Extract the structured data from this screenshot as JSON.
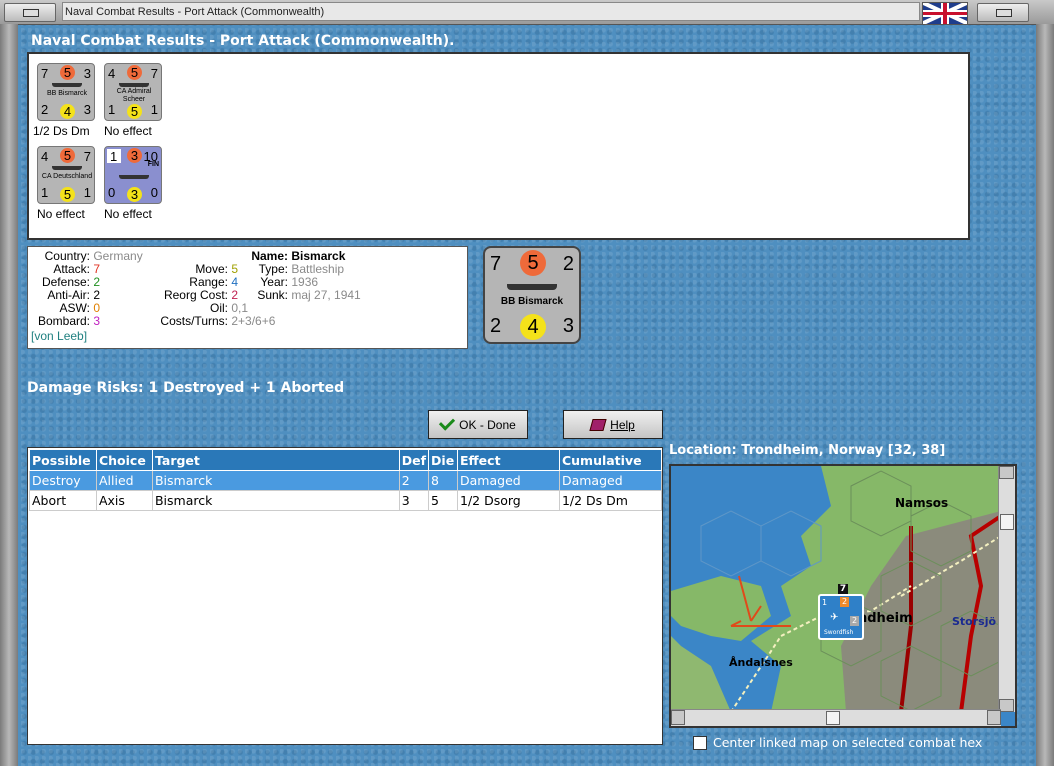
{
  "window": {
    "title": "Naval Combat Results - Port Attack (Commonwealth)"
  },
  "heading": "Naval Combat Results - Port Attack (Commonwealth).",
  "results": [
    {
      "top_left": "7",
      "top_circle": "5",
      "top_right": "3",
      "name": "BB Bismarck",
      "bottom_left": "2",
      "bottom_circle": "4",
      "bottom_right": "3",
      "caption": "1/2 Ds Dm"
    },
    {
      "top_left": "4",
      "top_circle": "5",
      "top_right": "7",
      "name": "CA Admiral Scheer",
      "bottom_left": "1",
      "bottom_circle": "5",
      "bottom_right": "1",
      "caption": "No effect"
    },
    {
      "top_left": "4",
      "top_circle": "5",
      "top_right": "7",
      "name": "CA Deutschland",
      "bottom_left": "1",
      "bottom_circle": "5",
      "bottom_right": "1",
      "caption": "No effect"
    },
    {
      "top_left": "1",
      "top_circle": "3",
      "top_right": "10",
      "tag": "FIN",
      "bottom_left": "0",
      "bottom_circle": "3",
      "bottom_right": "0",
      "caption": "No effect"
    }
  ],
  "info": {
    "country_label": "Country:",
    "country": "Germany",
    "attack_label": "Attack:",
    "attack": "7",
    "defense_label": "Defense:",
    "defense": "2",
    "antiair_label": "Anti-Air:",
    "antiair": "2",
    "asw_label": "ASW:",
    "asw": "0",
    "bombard_label": "Bombard:",
    "bombard": "3",
    "leader": "[von Leeb]",
    "move_label": "Move:",
    "move": "5",
    "range_label": "Range:",
    "range": "4",
    "reorg_label": "Reorg Cost:",
    "reorg": "2",
    "oil_label": "Oil:",
    "oil": "0,1",
    "costs_label": "Costs/Turns:",
    "costs": "2+3/6+6",
    "name_label": "Name:",
    "name": "Bismarck",
    "type_label": "Type:",
    "type": "Battleship",
    "year_label": "Year:",
    "year": "1936",
    "sunk_label": "Sunk:",
    "sunk": "maj 27, 1941",
    "colors": {
      "attack": "#e03020",
      "defense": "#209020",
      "asw": "#e08000",
      "bombard": "#c020c0",
      "move": "#a0a000",
      "range": "#2070c0",
      "reorg": "#c02050",
      "leader": "#208080"
    }
  },
  "big_counter": {
    "top_left": "7",
    "top_circle": "5",
    "top_right": "2",
    "name": "BB Bismarck",
    "bottom_left": "2",
    "bottom_circle": "4",
    "bottom_right": "3"
  },
  "damage_risks": "Damage Risks:  1 Destroyed + 1 Aborted",
  "buttons": {
    "ok": "OK - Done",
    "help": "Help"
  },
  "table": {
    "headers": [
      "Possible",
      "Choice",
      "Target",
      "Def",
      "Die",
      "Effect",
      "Cumulative"
    ],
    "rows": [
      [
        "Destroy",
        "Allied",
        "Bismarck",
        "2",
        "8",
        "Damaged",
        "Damaged"
      ],
      [
        "Abort",
        "Axis",
        "Bismarck",
        "3",
        "5",
        "1/2 Dsorg",
        "1/2 Ds Dm"
      ]
    ]
  },
  "location": "Location:  Trondheim, Norway [32, 38]",
  "map": {
    "labels": {
      "namsos": "Namsos",
      "trondheim": "ndheim",
      "storsjo": "Storsjö",
      "andalsnes": "Åndalsnes"
    },
    "unit": {
      "top": "2",
      "right": "2",
      "left": "1",
      "name": "Swordfish",
      "stack": "7"
    }
  },
  "center_linked": "Center linked map on selected combat hex"
}
